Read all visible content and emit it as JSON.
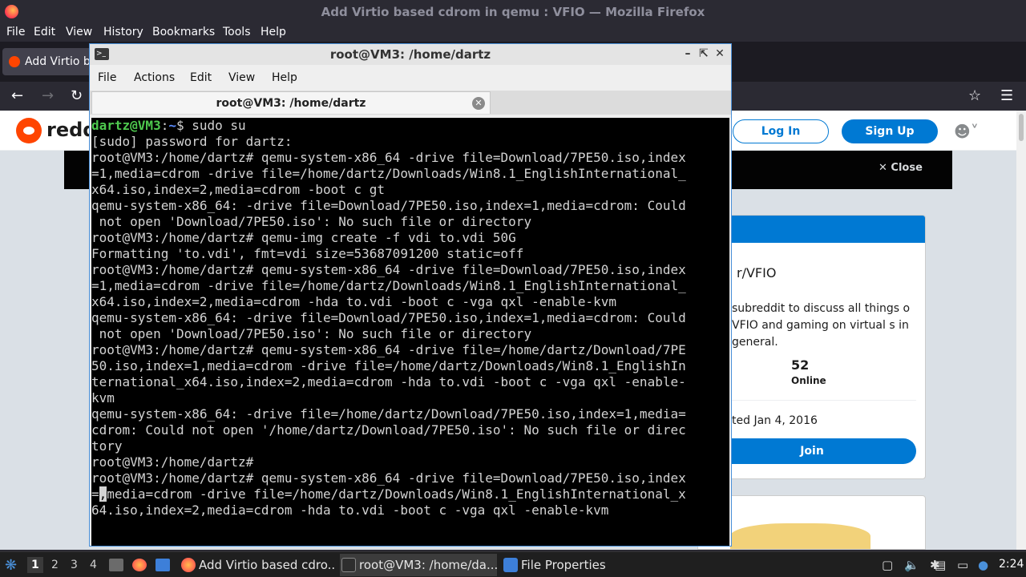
{
  "firefox": {
    "window_title": "Add Virtio based cdrom in qemu : VFIO — Mozilla Firefox",
    "menu": [
      "File",
      "Edit",
      "View",
      "History",
      "Bookmarks",
      "Tools",
      "Help"
    ],
    "tab_title": "Add Virtio b",
    "reddit": {
      "wordmark": "reddi",
      "login": "Log In",
      "signup": "Sign Up",
      "close": "Close",
      "subreddit": "r/VFIO",
      "description": "subreddit to discuss all things o VFIO and gaming on virtual s in general.",
      "online_count": "52",
      "online_label": "Online",
      "created": "ted Jan 4, 2016",
      "join": "Join"
    }
  },
  "terminal": {
    "title": "root@VM3: /home/dartz",
    "menu": [
      "File",
      "Actions",
      "Edit",
      "View",
      "Help"
    ],
    "tab_label": "root@VM3: /home/dartz",
    "lines": [
      {
        "user": "dartz@VM3",
        "path": "~",
        "rest": "$ sudo su"
      },
      {
        "text": "[sudo] password for dartz:"
      },
      {
        "text": "root@VM3:/home/dartz# qemu-system-x86_64 -drive file=Download/7PE50.iso,index"
      },
      {
        "text": "=1,media=cdrom -drive file=/home/dartz/Downloads/Win8.1_EnglishInternational_"
      },
      {
        "text": "x64.iso,index=2,media=cdrom -boot c gt"
      },
      {
        "text": "qemu-system-x86_64: -drive file=Download/7PE50.iso,index=1,media=cdrom: Could"
      },
      {
        "text": " not open 'Download/7PE50.iso': No such file or directory"
      },
      {
        "text": "root@VM3:/home/dartz# qemu-img create -f vdi to.vdi 50G"
      },
      {
        "text": "Formatting 'to.vdi', fmt=vdi size=53687091200 static=off"
      },
      {
        "text": "root@VM3:/home/dartz# qemu-system-x86_64 -drive file=Download/7PE50.iso,index"
      },
      {
        "text": "=1,media=cdrom -drive file=/home/dartz/Downloads/Win8.1_EnglishInternational_"
      },
      {
        "text": "x64.iso,index=2,media=cdrom -hda to.vdi -boot c -vga qxl -enable-kvm"
      },
      {
        "text": "qemu-system-x86_64: -drive file=Download/7PE50.iso,index=1,media=cdrom: Could"
      },
      {
        "text": " not open 'Download/7PE50.iso': No such file or directory"
      },
      {
        "text": "root@VM3:/home/dartz# qemu-system-x86_64 -drive file=/home/dartz/Download/7PE"
      },
      {
        "text": "50.iso,index=1,media=cdrom -drive file=/home/dartz/Downloads/Win8.1_EnglishIn"
      },
      {
        "text": "ternational_x64.iso,index=2,media=cdrom -hda to.vdi -boot c -vga qxl -enable-"
      },
      {
        "text": "kvm"
      },
      {
        "text": "qemu-system-x86_64: -drive file=/home/dartz/Download/7PE50.iso,index=1,media="
      },
      {
        "text": "cdrom: Could not open '/home/dartz/Download/7PE50.iso': No such file or direc"
      },
      {
        "text": "tory"
      },
      {
        "text": "root@VM3:/home/dartz#"
      },
      {
        "text": "root@VM3:/home/dartz# qemu-system-x86_64 -drive file=Download/7PE50.iso,index"
      },
      {
        "pre": "=",
        "cursor": ",",
        "post": "media=cdrom -drive file=/home/dartz/Downloads/Win8.1_EnglishInternational_x"
      },
      {
        "text": "64.iso,index=2,media=cdrom -hda to.vdi -boot c -vga qxl -enable-kvm"
      }
    ]
  },
  "taskbar": {
    "workspaces": [
      "1",
      "2",
      "3",
      "4"
    ],
    "tasks": [
      "Add Virtio based cdro...",
      "root@VM3: /home/da...",
      "File Properties"
    ],
    "clock": "2:24"
  }
}
